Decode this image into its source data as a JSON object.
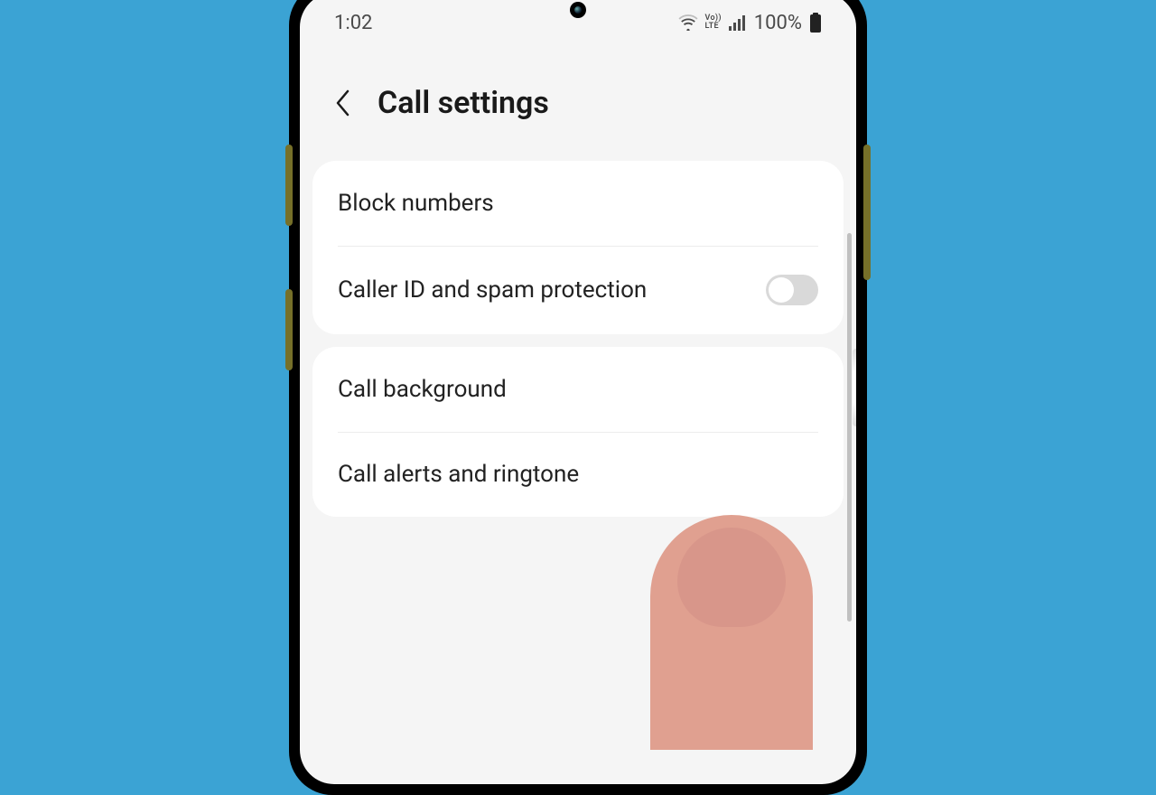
{
  "status": {
    "time": "1:02",
    "volte_top": "Vo))",
    "volte_bottom": "LTE",
    "battery_text": "100%"
  },
  "header": {
    "title": "Call settings"
  },
  "groups": [
    {
      "rows": [
        {
          "label": "Block numbers",
          "toggle": false
        },
        {
          "label": "Caller ID and spam protection",
          "toggle": true,
          "toggle_on": false
        }
      ]
    },
    {
      "rows": [
        {
          "label": "Call background",
          "toggle": false
        },
        {
          "label": "Call alerts and ringtone",
          "toggle": false
        }
      ]
    }
  ]
}
